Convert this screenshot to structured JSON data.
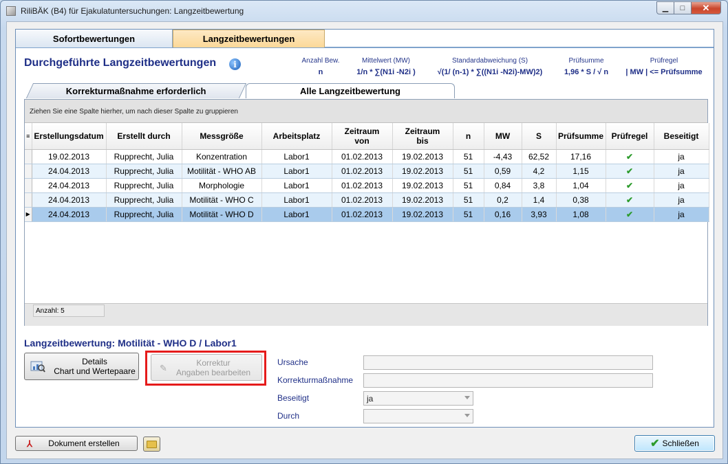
{
  "window": {
    "title": "RiliBÄK (B4) für Ejakulatuntersuchungen: Langzeitbewertung"
  },
  "top_tabs": [
    "Sofortbewertungen",
    "Langzeitbewertungen"
  ],
  "heading": "Durchgeführte Langzeitbewertungen",
  "stats": [
    {
      "label": "Anzahl Bew.",
      "formula": "n"
    },
    {
      "label": "Mittelwert (MW)",
      "formula": "1/n * ∑(N1i -N2i )"
    },
    {
      "label": "Standardabweichung (S)",
      "formula": "√(1/ (n-1) * ∑((N1i -N2i)-MW)2)"
    },
    {
      "label": "Prüfsumme",
      "formula": "1,96 * S / √ n"
    },
    {
      "label": "Prüfregel",
      "formula": "| MW |  <= Prüfsumme"
    }
  ],
  "sub_tabs": [
    "Korrekturmaßnahme erforderlich",
    "Alle Langzeitbewertung"
  ],
  "group_hint": "Ziehen Sie eine Spalte hierher, um nach dieser Spalte zu gruppieren",
  "columns": [
    "Erstellungsdatum",
    "Erstellt durch",
    "Messgröße",
    "Arbeitsplatz",
    "Zeitraum von",
    "Zeitraum bis",
    "n",
    "MW",
    "S",
    "Prüfsumme",
    "Prüfregel",
    "Beseitigt"
  ],
  "rows": [
    [
      "19.02.2013",
      "Rupprecht, Julia",
      "Konzentration",
      "Labor1",
      "01.02.2013",
      "19.02.2013",
      "51",
      "-4,43",
      "62,52",
      "17,16",
      "✔",
      "ja"
    ],
    [
      "24.04.2013",
      "Rupprecht, Julia",
      "Motilität - WHO AB",
      "Labor1",
      "01.02.2013",
      "19.02.2013",
      "51",
      "0,59",
      "4,2",
      "1,15",
      "✔",
      "ja"
    ],
    [
      "24.04.2013",
      "Rupprecht, Julia",
      "Morphologie",
      "Labor1",
      "01.02.2013",
      "19.02.2013",
      "51",
      "0,84",
      "3,8",
      "1,04",
      "✔",
      "ja"
    ],
    [
      "24.04.2013",
      "Rupprecht, Julia",
      "Motilität - WHO C",
      "Labor1",
      "01.02.2013",
      "19.02.2013",
      "51",
      "0,2",
      "1,4",
      "0,38",
      "✔",
      "ja"
    ],
    [
      "24.04.2013",
      "Rupprecht, Julia",
      "Motilität - WHO D",
      "Labor1",
      "01.02.2013",
      "19.02.2013",
      "51",
      "0,16",
      "3,93",
      "1,08",
      "✔",
      "ja"
    ]
  ],
  "selected_row": 4,
  "count_label": "Anzahl: 5",
  "detail": {
    "title": "Langzeitbewertung:  Motilität - WHO D / Labor1",
    "details_button": [
      "Details",
      "Chart und Wertepaare"
    ],
    "korrektur_button": [
      "Korrektur",
      "Angaben bearbeiten"
    ],
    "fields": {
      "ursache_label": "Ursache",
      "korrektur_label": "Korrekturmaßnahme",
      "beseitigt_label": "Beseitigt",
      "beseitigt_value": "ja",
      "durch_label": "Durch",
      "durch_value": ""
    }
  },
  "footer": {
    "document_button": "Dokument erstellen",
    "close_button": "Schließen"
  },
  "colors": {
    "heading": "#1f2f87",
    "selected_row": "#a9cbec",
    "alt_row": "#e8f3fc",
    "highlight": "#e51b1b",
    "check": "#2c9b2c"
  }
}
